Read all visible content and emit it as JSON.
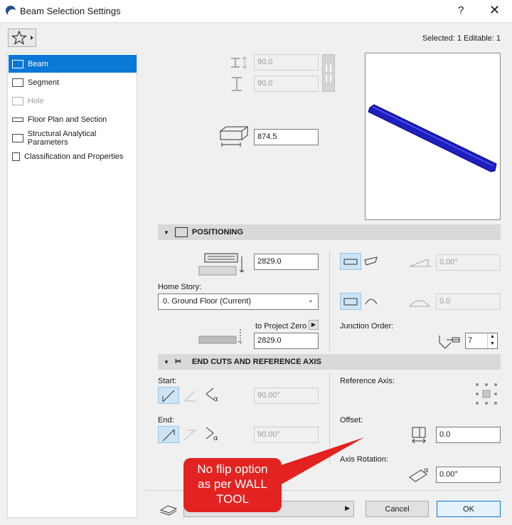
{
  "window": {
    "title": "Beam Selection Settings",
    "help_glyph": "?",
    "close_glyph": "✕"
  },
  "toolbar": {
    "favorites_icon": "star-icon",
    "selected_info": "Selected: 1 Editable: 1"
  },
  "sidebar": {
    "items": [
      {
        "label": "Beam",
        "icon": "beam-icon",
        "active": true
      },
      {
        "label": "Segment",
        "icon": "segment-icon"
      },
      {
        "label": "Hole",
        "icon": "hole-icon",
        "disabled": true
      },
      {
        "label": "Floor Plan and Section",
        "icon": "floorplan-icon"
      },
      {
        "label": "Structural Analytical Parameters",
        "icon": "structural-icon"
      },
      {
        "label": "Classification and Properties",
        "icon": "classification-icon"
      }
    ]
  },
  "geometry": {
    "width": "90.0",
    "height": "90.0",
    "length": "874.5"
  },
  "positioning": {
    "header": "POSITIONING",
    "elevation": "2829.0",
    "home_story_label": "Home Story:",
    "home_story_value": "0. Ground Floor (Current)",
    "to_project_zero_label": "to Project Zero",
    "project_zero_value": "2829.0",
    "slant_angle": "0.00°",
    "profile_value": "0.0",
    "junction_order_label": "Junction Order:",
    "junction_order_value": "7"
  },
  "end_cuts": {
    "header": "END CUTS AND REFERENCE AXIS",
    "start_label": "Start:",
    "start_angle": "90.00°",
    "end_label": "End:",
    "end_angle": "90.00°",
    "reference_axis_label": "Reference Axis:",
    "offset_label": "Offset:",
    "offset_value": "0.0",
    "axis_rotation_label": "Axis Rotation:",
    "axis_rotation_value": "0.00°"
  },
  "footer": {
    "cancel": "Cancel",
    "ok": "OK"
  },
  "callout": {
    "line1": "No flip option",
    "line2": "as per WALL",
    "line3": "TOOL"
  },
  "colors": {
    "accent": "#0a78d7",
    "callout": "#e32321",
    "beam": "#1f1fbf"
  }
}
